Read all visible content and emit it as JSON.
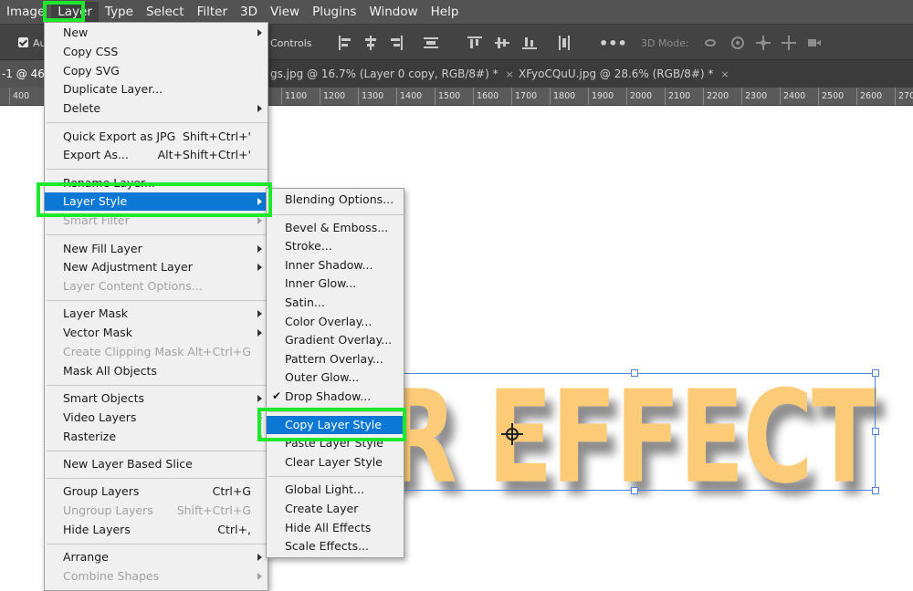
{
  "menubar": {
    "items": [
      "Image",
      "Layer",
      "Type",
      "Select",
      "Filter",
      "3D",
      "View",
      "Plugins",
      "Window",
      "Help"
    ],
    "active": "Layer"
  },
  "optionsbar": {
    "auto_select_label": "Au",
    "controls_label": "Controls",
    "mode_label": "3D Mode:"
  },
  "tabs": [
    {
      "label": "-1 @ 46.",
      "active": true
    },
    {
      "label": "gs.jpg @ 16.7% (Layer 0 copy, RGB/8#) *",
      "close": "×"
    },
    {
      "label": "XFyoCQuU.jpg @ 28.6% (RGB/8#) *",
      "close": "×"
    }
  ],
  "ruler": {
    "labels": [
      "400",
      "1100",
      "1200",
      "1300",
      "1400",
      "1500",
      "1600",
      "1700",
      "1800",
      "1900",
      "2000",
      "2100",
      "2200",
      "2300",
      "2400",
      "2500",
      "2600",
      "270"
    ]
  },
  "canvas": {
    "text": "R EFFECT"
  },
  "layer_menu": [
    {
      "label": "New",
      "arrow": true
    },
    {
      "label": "Copy CSS"
    },
    {
      "label": "Copy SVG"
    },
    {
      "label": "Duplicate Layer..."
    },
    {
      "label": "Delete",
      "arrow": true
    },
    {
      "separator": true
    },
    {
      "label": "Quick Export as JPG",
      "shortcut": "Shift+Ctrl+'"
    },
    {
      "label": "Export As...",
      "shortcut": "Alt+Shift+Ctrl+'"
    },
    {
      "separator": true
    },
    {
      "label": "Rename Layer..."
    },
    {
      "label": "Layer Style",
      "arrow": true,
      "highlight": true
    },
    {
      "label": "Smart Filter",
      "arrow": true,
      "disabled": true
    },
    {
      "separator": true
    },
    {
      "label": "New Fill Layer",
      "arrow": true
    },
    {
      "label": "New Adjustment Layer",
      "arrow": true
    },
    {
      "label": "Layer Content Options...",
      "disabled": true
    },
    {
      "separator": true
    },
    {
      "label": "Layer Mask",
      "arrow": true
    },
    {
      "label": "Vector Mask",
      "arrow": true
    },
    {
      "label": "Create Clipping Mask",
      "shortcut": "Alt+Ctrl+G",
      "disabled": true
    },
    {
      "label": "Mask All Objects"
    },
    {
      "separator": true
    },
    {
      "label": "Smart Objects",
      "arrow": true
    },
    {
      "label": "Video Layers",
      "arrow": true
    },
    {
      "label": "Rasterize",
      "arrow": true
    },
    {
      "separator": true
    },
    {
      "label": "New Layer Based Slice"
    },
    {
      "separator": true
    },
    {
      "label": "Group Layers",
      "shortcut": "Ctrl+G"
    },
    {
      "label": "Ungroup Layers",
      "shortcut": "Shift+Ctrl+G",
      "disabled": true
    },
    {
      "label": "Hide Layers",
      "shortcut": "Ctrl+,"
    },
    {
      "separator": true
    },
    {
      "label": "Arrange",
      "arrow": true
    },
    {
      "label": "Combine Shapes",
      "arrow": true,
      "disabled": true
    }
  ],
  "style_menu": [
    {
      "label": "Blending Options..."
    },
    {
      "separator": true
    },
    {
      "label": "Bevel & Emboss..."
    },
    {
      "label": "Stroke..."
    },
    {
      "label": "Inner Shadow..."
    },
    {
      "label": "Inner Glow..."
    },
    {
      "label": "Satin..."
    },
    {
      "label": "Color Overlay..."
    },
    {
      "label": "Gradient Overlay..."
    },
    {
      "label": "Pattern Overlay..."
    },
    {
      "label": "Outer Glow..."
    },
    {
      "label": "Drop Shadow...",
      "checked": true
    },
    {
      "separator": true
    },
    {
      "label": "Copy Layer Style",
      "highlight": true
    },
    {
      "label": "Paste Layer Style"
    },
    {
      "label": "Clear Layer Style"
    },
    {
      "separator": true
    },
    {
      "label": "Global Light..."
    },
    {
      "label": "Create Layer"
    },
    {
      "label": "Hide All Effects"
    },
    {
      "label": "Scale Effects..."
    }
  ],
  "colors": {
    "highlight": "#0a78d4",
    "callout": "#1ee82b",
    "text_fill": "#fccb77"
  }
}
